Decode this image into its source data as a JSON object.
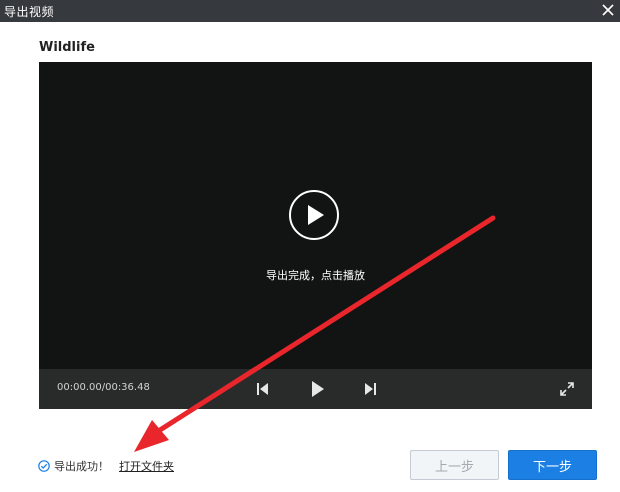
{
  "window": {
    "title": "导出视频"
  },
  "video": {
    "name": "Wildlife"
  },
  "player": {
    "status": "导出完成，点击播放",
    "time_display": "00:00.00/00:36.48"
  },
  "footer": {
    "status_text": "导出成功！",
    "open_folder_link": "打开文件夹",
    "prev_button": "上一步",
    "next_button": "下一步"
  },
  "colors": {
    "titlebar": "#36393e",
    "player_bg": "#121413",
    "controls_bg": "#282b2a",
    "accent_blue": "#1b7fe3",
    "annotation_red": "#e8262b"
  }
}
